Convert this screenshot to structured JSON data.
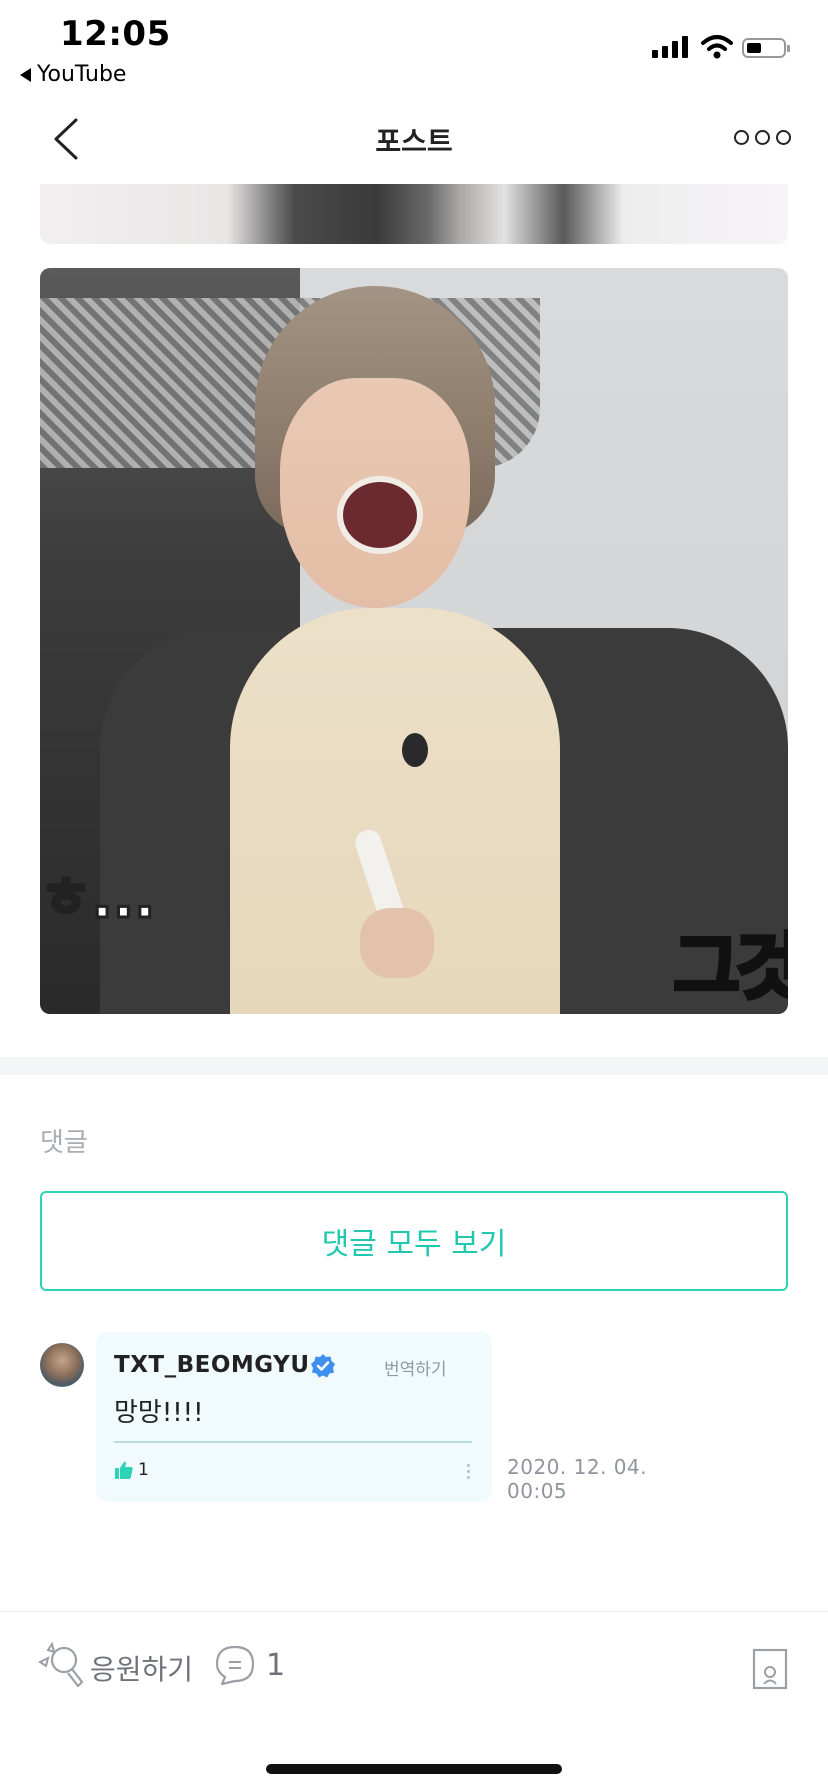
{
  "status_bar": {
    "time": "12:05",
    "back_app": "YouTube"
  },
  "header": {
    "title": "포스트"
  },
  "post_image": {
    "caption_left": "ㅎ...",
    "caption_right": "그것"
  },
  "comments": {
    "section_label": "댓글",
    "view_all_label": "댓글 모두 보기",
    "items": [
      {
        "author": "TXT_BEOMGYU",
        "verified": true,
        "translate_label": "번역하기",
        "text": "망망!!!!",
        "likes": "1",
        "date": "2020. 12. 04.",
        "time": "00:05"
      }
    ]
  },
  "bottom_bar": {
    "cheer_label": "응원하기",
    "comment_count": "1"
  },
  "colors": {
    "accent": "#2cd3b6",
    "bubble_bg": "#f1fbfd",
    "verified": "#3d8ff0"
  }
}
